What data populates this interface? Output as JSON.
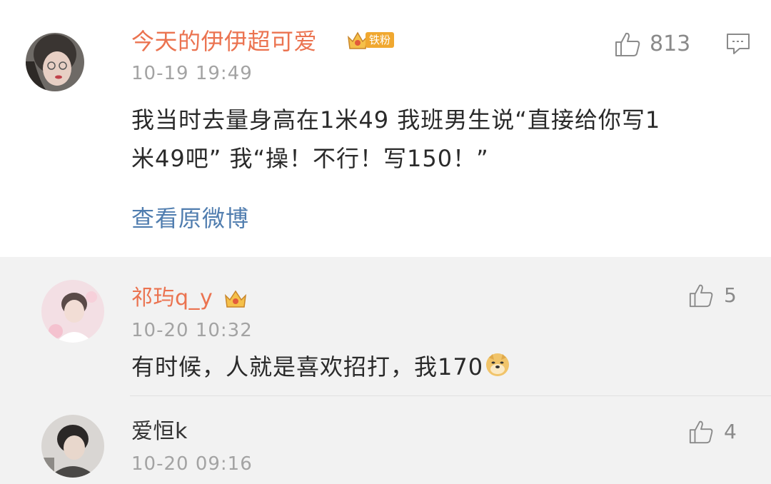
{
  "main_comment": {
    "username": "今天的伊伊超可爱",
    "badge": "铁粉",
    "time": "10-19 19:49",
    "like_count": "813",
    "content_line1": "我当时去量身高在1米49 我班男生说“直接给你写1",
    "content_line2": "米49吧” 我“操！不行！写150！”",
    "view_original": "查看原微博",
    "colors": {
      "username": "#eb7350",
      "link": "#507daf",
      "badge": "#f0a830"
    },
    "icons": [
      "crown-icon",
      "thumbs-up-icon",
      "comment-icon"
    ]
  },
  "replies": [
    {
      "username": "祁玙q_y",
      "time": "10-20 10:32",
      "like_count": "5",
      "content": "有时候，人就是喜欢招打，我170",
      "emoji": "doge-emoji",
      "username_color": "#eb7350"
    },
    {
      "username": "爱恒k",
      "time": "10-20 09:16",
      "like_count": "4",
      "username_color": "#333333"
    }
  ]
}
